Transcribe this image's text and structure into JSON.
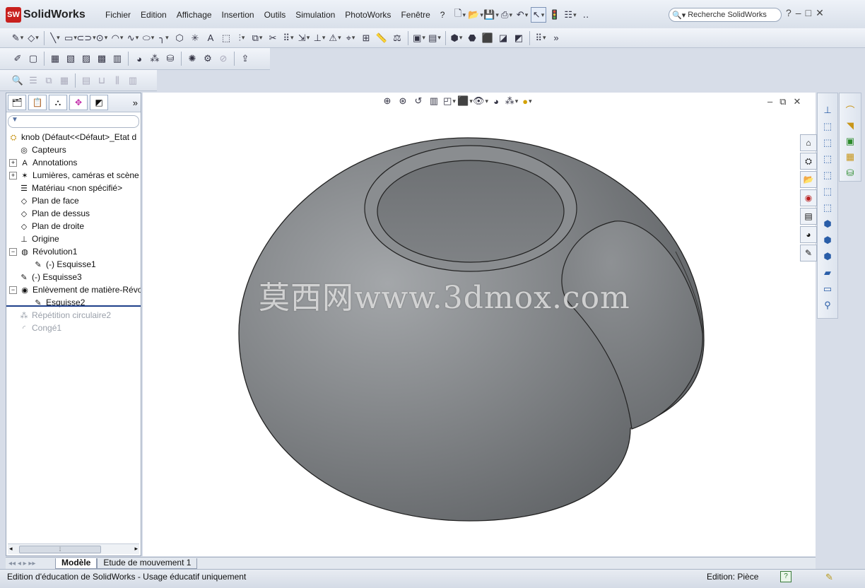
{
  "app": {
    "title": "SolidWorks",
    "logo_badge": "SW"
  },
  "menu": [
    "Fichier",
    "Edition",
    "Affichage",
    "Insertion",
    "Outils",
    "Simulation",
    "PhotoWorks",
    "Fenêtre",
    "?"
  ],
  "search": {
    "placeholder": "Recherche SolidWorks"
  },
  "window_controls": [
    "?",
    "–",
    "□",
    "✕"
  ],
  "feature_tree": {
    "root": "knob  (Défaut<<Défaut>_Etat d",
    "items": [
      {
        "label": "Capteurs",
        "icon": "sensor-icon",
        "expandable": false,
        "suppressed": false,
        "indent": 1
      },
      {
        "label": "Annotations",
        "icon": "annotation-icon",
        "expandable": true,
        "suppressed": false,
        "indent": 1
      },
      {
        "label": "Lumières, caméras et scène",
        "icon": "lights-icon",
        "expandable": true,
        "suppressed": false,
        "indent": 1
      },
      {
        "label": "Matériau <non spécifié>",
        "icon": "material-icon",
        "expandable": false,
        "suppressed": false,
        "indent": 1
      },
      {
        "label": "Plan de face",
        "icon": "plane-icon",
        "expandable": false,
        "suppressed": false,
        "indent": 1
      },
      {
        "label": "Plan de dessus",
        "icon": "plane-icon",
        "expandable": false,
        "suppressed": false,
        "indent": 1
      },
      {
        "label": "Plan de droite",
        "icon": "plane-icon",
        "expandable": false,
        "suppressed": false,
        "indent": 1
      },
      {
        "label": "Origine",
        "icon": "origin-icon",
        "expandable": false,
        "suppressed": false,
        "indent": 1
      },
      {
        "label": "Révolution1",
        "icon": "revolve-icon",
        "expandable": true,
        "expanded": true,
        "suppressed": false,
        "indent": 1
      },
      {
        "label": "(-) Esquisse1",
        "icon": "sketch-icon",
        "expandable": false,
        "suppressed": false,
        "indent": 2
      },
      {
        "label": "(-) Esquisse3",
        "icon": "sketch-icon",
        "expandable": false,
        "suppressed": false,
        "indent": 1
      },
      {
        "label": "Enlèvement de matière-Révo",
        "icon": "cut-revolve-icon",
        "expandable": true,
        "expanded": true,
        "suppressed": false,
        "indent": 1
      },
      {
        "label": "Esquisse2",
        "icon": "sketch-icon",
        "expandable": false,
        "suppressed": false,
        "indent": 2
      },
      {
        "label": "Répétition circulaire2",
        "icon": "circular-pattern-icon",
        "expandable": false,
        "suppressed": true,
        "indent": 1
      },
      {
        "label": "Congé1",
        "icon": "fillet-icon",
        "expandable": false,
        "suppressed": true,
        "indent": 1
      }
    ]
  },
  "watermark": "莫西网www.3dmox.com",
  "bottom_tabs": [
    "Modèle",
    "Etude de mouvement 1"
  ],
  "status": {
    "left": "Edition d'éducation de SolidWorks - Usage éducatif uniquement",
    "mode": "Edition: Pièce",
    "help_glyph": "?"
  },
  "colors": {
    "model_gray": "#7b7e81",
    "accent": "#1e3f8a",
    "logo_red": "#c8201e"
  }
}
